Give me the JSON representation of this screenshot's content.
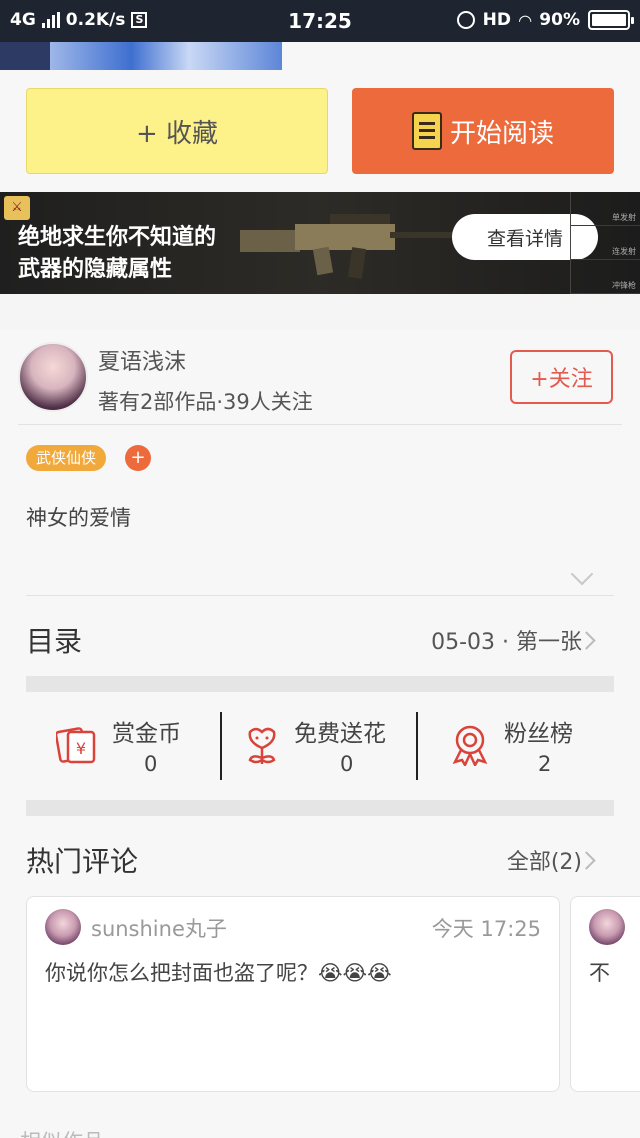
{
  "status_bar": {
    "network": "4G",
    "speed": "0.2K/s",
    "time": "17:25",
    "hd": "HD",
    "battery": "90%"
  },
  "actions": {
    "collect_label": "+ 收藏",
    "read_label": "开始阅读"
  },
  "banner": {
    "title_line1": "绝地求生你不知道的",
    "title_line2": "武器的隐藏属性",
    "button": "查看详情",
    "side_items": [
      "单发射",
      "连发射",
      "冲锋枪"
    ]
  },
  "author": {
    "name": "夏语浅沫",
    "meta": "著有2部作品·39人关注",
    "follow_label": "+关注",
    "tag": "武侠仙侠",
    "tag_add": "+"
  },
  "book": {
    "description": "神女的爱情"
  },
  "toc": {
    "title": "目录",
    "latest": "05-03 · 第一张"
  },
  "stats": [
    {
      "label": "赏金币",
      "value": "0",
      "icon": "coin-envelope-icon"
    },
    {
      "label": "免费送花",
      "value": "0",
      "icon": "flower-icon"
    },
    {
      "label": "粉丝榜",
      "value": "2",
      "icon": "medal-icon"
    }
  ],
  "comments": {
    "title": "热门评论",
    "all_label": "全部(2)",
    "items": [
      {
        "user": "sunshine丸子",
        "time": "今天 17:25",
        "text": "你说你怎么把封面也盗了呢？😭😭😭"
      },
      {
        "text": "不"
      }
    ]
  },
  "next_section": "相似作品",
  "colors": {
    "accent_orange": "#ec6a3b",
    "collect_yellow": "#fdf28a",
    "follow_red": "#e35a4e",
    "tag_orange": "#f2a93b"
  }
}
